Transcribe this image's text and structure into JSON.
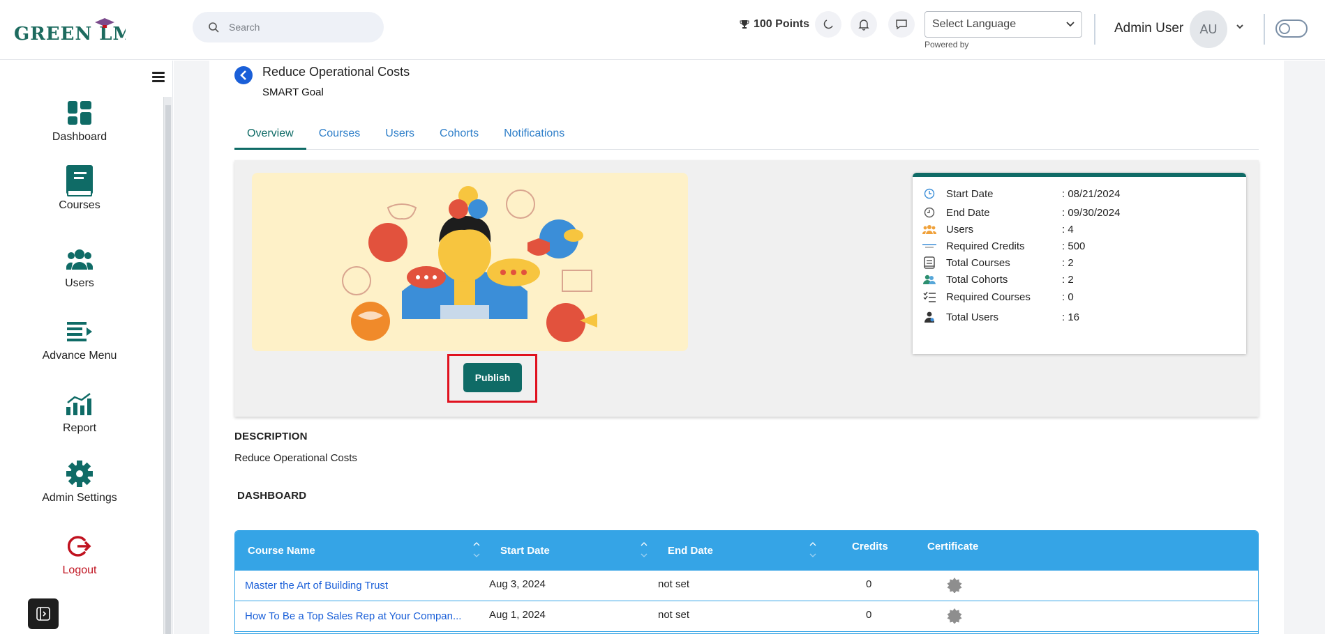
{
  "header": {
    "logo_text": "GREEN LMS",
    "search_placeholder": "Search",
    "points": "100 Points",
    "language_select": "Select Language",
    "powered_by": "Powered by",
    "user_name": "Admin User",
    "avatar_initials": "AU"
  },
  "sidebar": {
    "items": [
      {
        "label": "Dashboard",
        "icon": "dashboard-icon"
      },
      {
        "label": "Courses",
        "icon": "book-icon"
      },
      {
        "label": "Users",
        "icon": "users-icon"
      },
      {
        "label": "Advance Menu",
        "icon": "menu-icon"
      },
      {
        "label": "Report",
        "icon": "chart-icon"
      },
      {
        "label": "Admin Settings",
        "icon": "gear-icon"
      },
      {
        "label": "Logout",
        "icon": "logout-icon"
      }
    ]
  },
  "goal": {
    "title": "Reduce Operational Costs",
    "type": "SMART Goal"
  },
  "tabs": [
    "Overview",
    "Courses",
    "Users",
    "Cohorts",
    "Notifications"
  ],
  "publish_label": "Publish",
  "stats": [
    {
      "label": "Start Date",
      "value": ": 08/21/2024",
      "icon": "clock-icon"
    },
    {
      "label": "End Date",
      "value": ": 09/30/2024",
      "icon": "clock-end-icon"
    },
    {
      "label": "Users",
      "value": ": 4",
      "icon": "users-group-icon"
    },
    {
      "label": "Required Credits",
      "value": ": 500",
      "icon": "credits-icon"
    },
    {
      "label": "Total Courses",
      "value": ": 2",
      "icon": "courses-icon"
    },
    {
      "label": "Total Cohorts",
      "value": ": 2",
      "icon": "cohorts-icon"
    },
    {
      "label": "Required Courses",
      "value": ": 0",
      "icon": "checklist-icon"
    },
    {
      "label": "Total Users",
      "value": ": 16",
      "icon": "user-icon"
    }
  ],
  "description": {
    "heading": "DESCRIPTION",
    "text": "Reduce Operational Costs"
  },
  "dashboard": {
    "heading": "DASHBOARD",
    "columns": [
      "Course Name",
      "Start Date",
      "End Date",
      "Credits",
      "Certificate"
    ],
    "rows": [
      {
        "course": "Master the Art of Building Trust",
        "start": "Aug 3, 2024",
        "end": "not set",
        "credits": "0"
      },
      {
        "course": "How To Be a Top Sales Rep at Your Compan...",
        "start": "Aug 1, 2024",
        "end": "not set",
        "credits": "0"
      }
    ]
  },
  "colors": {
    "brand": "#0f6b66",
    "table_header": "#35a4e6",
    "link": "#1a5fd8",
    "logout": "#c0121f",
    "highlight": "#e0121f"
  }
}
